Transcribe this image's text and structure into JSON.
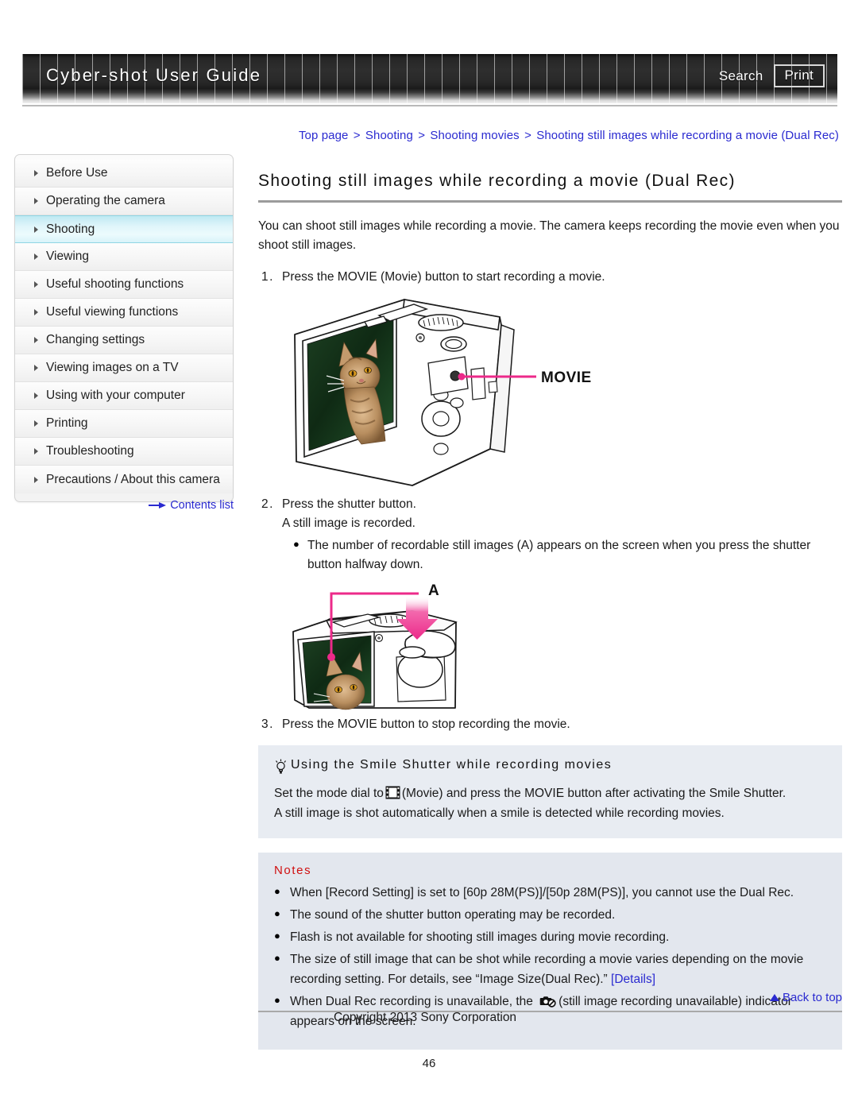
{
  "header": {
    "title": "Cyber-shot User Guide",
    "search_label": "Search",
    "print_label": "Print"
  },
  "breadcrumb": {
    "items": [
      "Top page",
      "Shooting",
      "Shooting movies",
      "Shooting still images while recording a movie (Dual Rec)"
    ],
    "separator": ">"
  },
  "sidebar": {
    "items": [
      {
        "label": "Before Use",
        "active": false
      },
      {
        "label": "Operating the camera",
        "active": false
      },
      {
        "label": "Shooting",
        "active": true
      },
      {
        "label": "Viewing",
        "active": false
      },
      {
        "label": "Useful shooting functions",
        "active": false
      },
      {
        "label": "Useful viewing functions",
        "active": false
      },
      {
        "label": "Changing settings",
        "active": false
      },
      {
        "label": "Viewing images on a TV",
        "active": false
      },
      {
        "label": "Using with your computer",
        "active": false
      },
      {
        "label": "Printing",
        "active": false
      },
      {
        "label": "Troubleshooting",
        "active": false
      },
      {
        "label": "Precautions / About this camera",
        "active": false
      }
    ],
    "contents_list_label": "Contents list"
  },
  "main": {
    "title": "Shooting still images while recording a movie (Dual Rec)",
    "lead": "You can shoot still images while recording a movie. The camera keeps recording the movie even when you shoot still images.",
    "step1_num": "1.",
    "step1_text": "Press the MOVIE (Movie) button to start recording a movie.",
    "figure1_callout": "MOVIE",
    "step2_num": "2.",
    "step2_text": "Press the shutter button.",
    "step2_sub": "A still image is recorded.",
    "step2_bullet": "The number of recordable still images (A) appears on the screen when you press the shutter button halfway down.",
    "figure2_callout": "A",
    "step3_num": "3.",
    "step3_text": "Press the MOVIE button to stop recording the movie."
  },
  "tip": {
    "heading": "Using the Smile Shutter while recording movies",
    "line1_before": "Set the mode dial to",
    "line1_after": "(Movie) and press the MOVIE button after activating the Smile Shutter.",
    "line2": "A still image is shot automatically when a smile is detected while recording movies."
  },
  "notes": {
    "heading": "Notes",
    "bullet_char": "•",
    "items": [
      {
        "text": "When [Record Setting] is set to [60p 28M(PS)]/[50p 28M(PS)], you cannot use the Dual Rec."
      },
      {
        "text": "The sound of the shutter button operating may be recorded."
      },
      {
        "text": "Flash is not available for shooting still images during movie recording."
      },
      {
        "text": "The size of still image that can be shot while recording a movie varies depending on the movie recording setting. For details, see “Image Size(Dual Rec).” ",
        "link": "[Details]"
      },
      {
        "text_before": "When Dual Rec recording is unavailable, the ",
        "text_after": "(still image recording unavailable) indicator appears on the screen."
      }
    ]
  },
  "footer": {
    "back_to_top": "Back to top",
    "copyright": "Copyright 2013 Sony Corporation",
    "page_number": "46"
  },
  "colors": {
    "link": "#2a2ad0",
    "notes_heading": "#d01010",
    "accent_pink": "#ec2a8a",
    "sidebar_active": "#cdeff7",
    "tip_bg": "#e8ecf2",
    "notes_bg": "#e3e7ee"
  }
}
